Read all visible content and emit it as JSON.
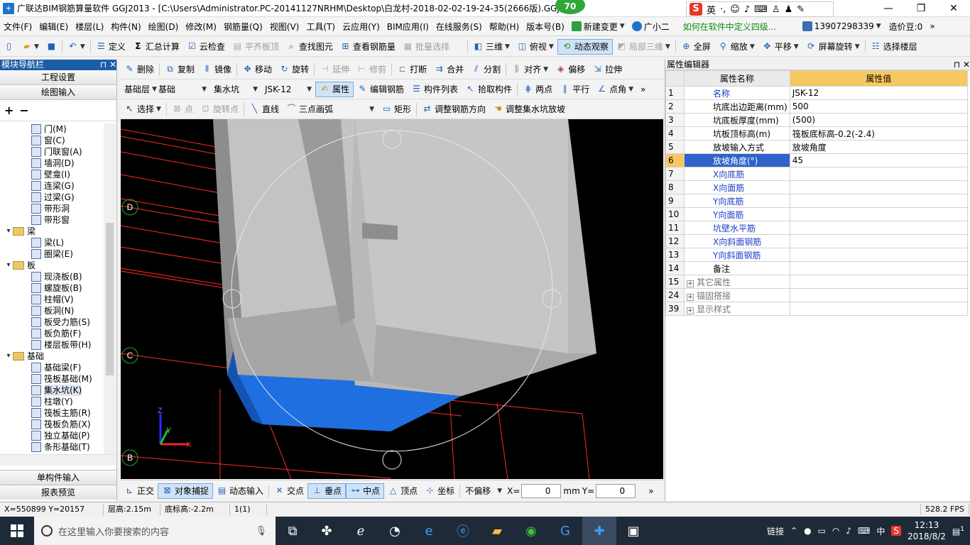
{
  "titlebar": {
    "title": "广联达BIM钢筋算量软件 GGJ2013 - [C:\\Users\\Administrator.PC-20141127NRHM\\Desktop\\白龙村-2018-02-02-19-24-35(2666版).GGJ12",
    "badge": "70",
    "ime_label": "英",
    "ime_logo": "S"
  },
  "menu": {
    "items": [
      "文件(F)",
      "编辑(E)",
      "楼层(L)",
      "构件(N)",
      "绘图(D)",
      "修改(M)",
      "钢筋量(Q)",
      "视图(V)",
      "工具(T)",
      "云应用(Y)",
      "BIM应用(I)",
      "在线服务(S)",
      "帮助(H)",
      "版本号(B)"
    ],
    "new_change": "新建变更",
    "assistant": "广小二",
    "hint": "如何在软件中定义四级...",
    "phone": "13907298339",
    "beans": "造价豆:0"
  },
  "toolbar1": {
    "define": "定义",
    "sum_calc": "汇总计算",
    "cloud_check": "云检查",
    "flush_slab": "平齐板顶",
    "find_element": "查找图元",
    "view_rebar": "查看钢筋量",
    "batch_select": "批量选择",
    "three_d": "三维",
    "top_view": "俯视",
    "dynamic_observe": "动态观察",
    "local_3d": "局部三维",
    "fullscreen": "全屏",
    "zoom": "缩放",
    "pan": "平移",
    "screen_rotate": "屏幕旋转",
    "select_floor": "选择楼层"
  },
  "toolbar2": {
    "delete": "删除",
    "copy": "复制",
    "mirror": "镜像",
    "move": "移动",
    "rotate": "旋转",
    "extend": "延伸",
    "trim": "修剪",
    "break": "打断",
    "merge": "合并",
    "split": "分割",
    "align": "对齐",
    "offset": "偏移",
    "stretch": "拉伸"
  },
  "toolbar3": {
    "layer": "基础层",
    "category": "基础",
    "type": "集水坑",
    "element": "JSK-12",
    "props": "属性",
    "edit_rebar": "编辑钢筋",
    "element_list": "构件列表",
    "pick_element": "拾取构件",
    "two_points": "两点",
    "parallel": "平行",
    "point_angle": "点角"
  },
  "toolbar4": {
    "select": "选择",
    "point": "点",
    "rotate_point": "旋转点",
    "line": "直线",
    "arc3": "三点画弧",
    "rect": "矩形",
    "adjust_rebar": "调整钢筋方向",
    "adjust_slope": "调整集水坑放坡"
  },
  "left": {
    "header": "模块导航栏",
    "btn_project": "工程设置",
    "btn_draw": "绘图输入",
    "btn_single": "单构件输入",
    "btn_report": "报表预览",
    "tree": [
      {
        "type": "leaf",
        "label": "门(M)"
      },
      {
        "type": "leaf",
        "label": "窗(C)"
      },
      {
        "type": "leaf",
        "label": "门联窗(A)"
      },
      {
        "type": "leaf",
        "label": "墙洞(D)"
      },
      {
        "type": "leaf",
        "label": "壁龛(I)"
      },
      {
        "type": "leaf",
        "label": "连梁(G)"
      },
      {
        "type": "leaf",
        "label": "过梁(G)"
      },
      {
        "type": "leaf",
        "label": "带形洞"
      },
      {
        "type": "leaf",
        "label": "带形窗"
      },
      {
        "type": "folder",
        "label": "梁"
      },
      {
        "type": "leaf",
        "label": "梁(L)"
      },
      {
        "type": "leaf",
        "label": "圈梁(E)"
      },
      {
        "type": "folder",
        "label": "板"
      },
      {
        "type": "leaf",
        "label": "现浇板(B)"
      },
      {
        "type": "leaf",
        "label": "螺旋板(B)"
      },
      {
        "type": "leaf",
        "label": "柱帽(V)"
      },
      {
        "type": "leaf",
        "label": "板洞(N)"
      },
      {
        "type": "leaf",
        "label": "板受力筋(S)"
      },
      {
        "type": "leaf",
        "label": "板负筋(F)"
      },
      {
        "type": "leaf",
        "label": "楼层板带(H)"
      },
      {
        "type": "folder",
        "label": "基础"
      },
      {
        "type": "leaf",
        "label": "基础梁(F)"
      },
      {
        "type": "leaf",
        "label": "筏板基础(M)"
      },
      {
        "type": "leaf",
        "label": "集水坑(K)",
        "selected": true
      },
      {
        "type": "leaf",
        "label": "柱墩(Y)"
      },
      {
        "type": "leaf",
        "label": "筏板主筋(R)"
      },
      {
        "type": "leaf",
        "label": "筏板负筋(X)"
      },
      {
        "type": "leaf",
        "label": "独立基础(P)"
      },
      {
        "type": "leaf",
        "label": "条形基础(T)"
      }
    ]
  },
  "canvas": {
    "axis_labels": [
      "D",
      "C",
      "B"
    ],
    "axes": {
      "x": "X",
      "y": "Y",
      "z": "Z"
    }
  },
  "snapbar": {
    "ortho": "正交",
    "snap": "对象捕捉",
    "dyn_input": "动态输入",
    "intersect": "交点",
    "perpendicular": "垂点",
    "midpoint": "中点",
    "vertex": "顶点",
    "coordinate": "坐标",
    "offset_mode": "不偏移",
    "x_label": "X=",
    "x_value": "0",
    "unit": "mm",
    "y_label": "Y=",
    "y_value": "0"
  },
  "right": {
    "header": "属性编辑器",
    "col_name": "属性名称",
    "col_value": "属性值",
    "rows": [
      {
        "n": "1",
        "name": "名称",
        "value": "JSK-12",
        "style": "blue"
      },
      {
        "n": "2",
        "name": "坑底出边距离(mm)",
        "value": "500",
        "style": "black"
      },
      {
        "n": "3",
        "name": "坑底板厚度(mm)",
        "value": "(500)",
        "style": "black"
      },
      {
        "n": "4",
        "name": "坑板顶标高(m)",
        "value": "筏板底标高-0.2(-2.4)",
        "style": "black"
      },
      {
        "n": "5",
        "name": "放坡输入方式",
        "value": "放坡角度",
        "style": "black"
      },
      {
        "n": "6",
        "name": "放坡角度(°)",
        "value": "45",
        "style": "selected"
      },
      {
        "n": "7",
        "name": "X向底筋",
        "value": "",
        "style": "blue"
      },
      {
        "n": "8",
        "name": "X向面筋",
        "value": "",
        "style": "blue"
      },
      {
        "n": "9",
        "name": "Y向底筋",
        "value": "",
        "style": "blue"
      },
      {
        "n": "10",
        "name": "Y向面筋",
        "value": "",
        "style": "blue"
      },
      {
        "n": "11",
        "name": "坑壁水平筋",
        "value": "",
        "style": "blue"
      },
      {
        "n": "12",
        "name": "X向斜面钢筋",
        "value": "",
        "style": "blue"
      },
      {
        "n": "13",
        "name": "Y向斜面钢筋",
        "value": "",
        "style": "blue"
      },
      {
        "n": "14",
        "name": "备注",
        "value": "",
        "style": "black"
      },
      {
        "n": "15",
        "name": "其它属性",
        "value": "",
        "style": "gray",
        "expand": true
      },
      {
        "n": "24",
        "name": "锚固搭接",
        "value": "",
        "style": "gray",
        "expand": true
      },
      {
        "n": "39",
        "name": "显示样式",
        "value": "",
        "style": "gray",
        "expand": true
      }
    ]
  },
  "status": {
    "coords": "X=550899 Y=20157",
    "floor_height": "层高:2.15m",
    "bottom_elev": "底标高:-2.2m",
    "count": "1(1)",
    "fps": "528.2 FPS"
  },
  "taskbar": {
    "search_placeholder": "在这里输入你要搜索的内容",
    "link": "链接",
    "ime": "中",
    "time": "12:13",
    "date": "2018/8/2",
    "notify_count": "1"
  },
  "colors": {
    "accent": "#1c5da8",
    "header_value": "#f6c860",
    "pit_blue": "#1f6fe0",
    "concrete": "#b9b9b9",
    "grid_red": "#ff2020"
  }
}
